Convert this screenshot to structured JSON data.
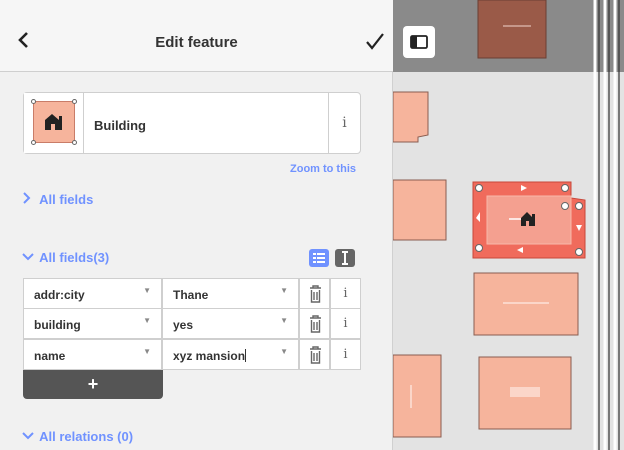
{
  "header": {
    "title": "Edit feature",
    "back_icon": "chevron-left-icon",
    "done_icon": "checkmark-icon"
  },
  "preset": {
    "name": "Building",
    "icon": "building-icon",
    "info_label": "i"
  },
  "zoom_link": "Zoom to this",
  "sections": {
    "fields_label": "All fields",
    "tags_label": "All fields(3)",
    "relations_label": "All relations (0)"
  },
  "tags": [
    {
      "key": "addr:city",
      "value": "Thane"
    },
    {
      "key": "building",
      "value": "yes"
    },
    {
      "key": "name",
      "value": "xyz mansion"
    }
  ],
  "tag_info_label": "i",
  "add_label": "+",
  "colors": {
    "accent": "#7092ff",
    "building_fill": "#f6b49c",
    "selected_fill": "#f06b5c",
    "map_bg": "#e3e3e3"
  }
}
